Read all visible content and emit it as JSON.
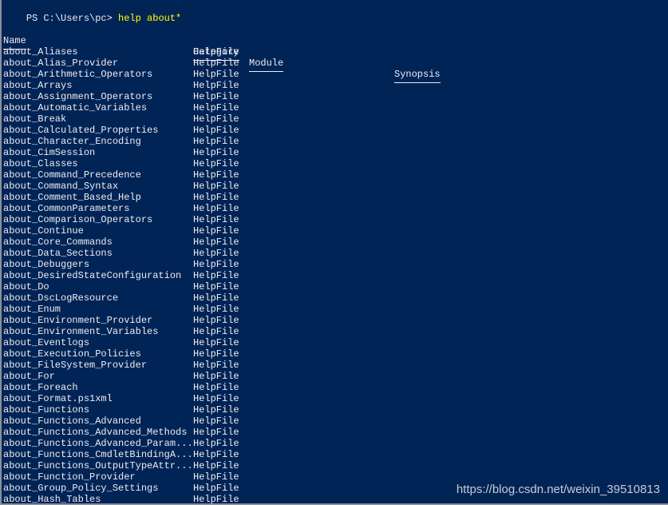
{
  "prompt": {
    "text": "PS C:\\Users\\pc> ",
    "command": "help about*"
  },
  "table": {
    "headers": [
      "Name",
      "Category",
      "Module",
      "Synopsis"
    ],
    "rows": [
      {
        "name": "about_Aliases",
        "category": "HelpFile"
      },
      {
        "name": "about_Alias_Provider",
        "category": "HelpFile"
      },
      {
        "name": "about_Arithmetic_Operators",
        "category": "HelpFile"
      },
      {
        "name": "about_Arrays",
        "category": "HelpFile"
      },
      {
        "name": "about_Assignment_Operators",
        "category": "HelpFile"
      },
      {
        "name": "about_Automatic_Variables",
        "category": "HelpFile"
      },
      {
        "name": "about_Break",
        "category": "HelpFile"
      },
      {
        "name": "about_Calculated_Properties",
        "category": "HelpFile"
      },
      {
        "name": "about_Character_Encoding",
        "category": "HelpFile"
      },
      {
        "name": "about_CimSession",
        "category": "HelpFile"
      },
      {
        "name": "about_Classes",
        "category": "HelpFile"
      },
      {
        "name": "about_Command_Precedence",
        "category": "HelpFile"
      },
      {
        "name": "about_Command_Syntax",
        "category": "HelpFile"
      },
      {
        "name": "about_Comment_Based_Help",
        "category": "HelpFile"
      },
      {
        "name": "about_CommonParameters",
        "category": "HelpFile"
      },
      {
        "name": "about_Comparison_Operators",
        "category": "HelpFile"
      },
      {
        "name": "about_Continue",
        "category": "HelpFile"
      },
      {
        "name": "about_Core_Commands",
        "category": "HelpFile"
      },
      {
        "name": "about_Data_Sections",
        "category": "HelpFile"
      },
      {
        "name": "about_Debuggers",
        "category": "HelpFile"
      },
      {
        "name": "about_DesiredStateConfiguration",
        "category": "HelpFile"
      },
      {
        "name": "about_Do",
        "category": "HelpFile"
      },
      {
        "name": "about_DscLogResource",
        "category": "HelpFile"
      },
      {
        "name": "about_Enum",
        "category": "HelpFile"
      },
      {
        "name": "about_Environment_Provider",
        "category": "HelpFile"
      },
      {
        "name": "about_Environment_Variables",
        "category": "HelpFile"
      },
      {
        "name": "about_Eventlogs",
        "category": "HelpFile"
      },
      {
        "name": "about_Execution_Policies",
        "category": "HelpFile"
      },
      {
        "name": "about_FileSystem_Provider",
        "category": "HelpFile"
      },
      {
        "name": "about_For",
        "category": "HelpFile"
      },
      {
        "name": "about_Foreach",
        "category": "HelpFile"
      },
      {
        "name": "about_Format.ps1xml",
        "category": "HelpFile"
      },
      {
        "name": "about_Functions",
        "category": "HelpFile"
      },
      {
        "name": "about_Functions_Advanced",
        "category": "HelpFile"
      },
      {
        "name": "about_Functions_Advanced_Methods",
        "category": "HelpFile"
      },
      {
        "name": "about_Functions_Advanced_Param...",
        "category": "HelpFile"
      },
      {
        "name": "about_Functions_CmdletBindingA...",
        "category": "HelpFile"
      },
      {
        "name": "about_Functions_OutputTypeAttr...",
        "category": "HelpFile"
      },
      {
        "name": "about_Function_Provider",
        "category": "HelpFile"
      },
      {
        "name": "about_Group_Policy_Settings",
        "category": "HelpFile"
      },
      {
        "name": "about_Hash_Tables",
        "category": "HelpFile"
      }
    ]
  },
  "watermark": "https://blog.csdn.net/weixin_39510813",
  "colors": {
    "background": "#012456",
    "text": "#eeedf0",
    "command": "#ffff00"
  }
}
